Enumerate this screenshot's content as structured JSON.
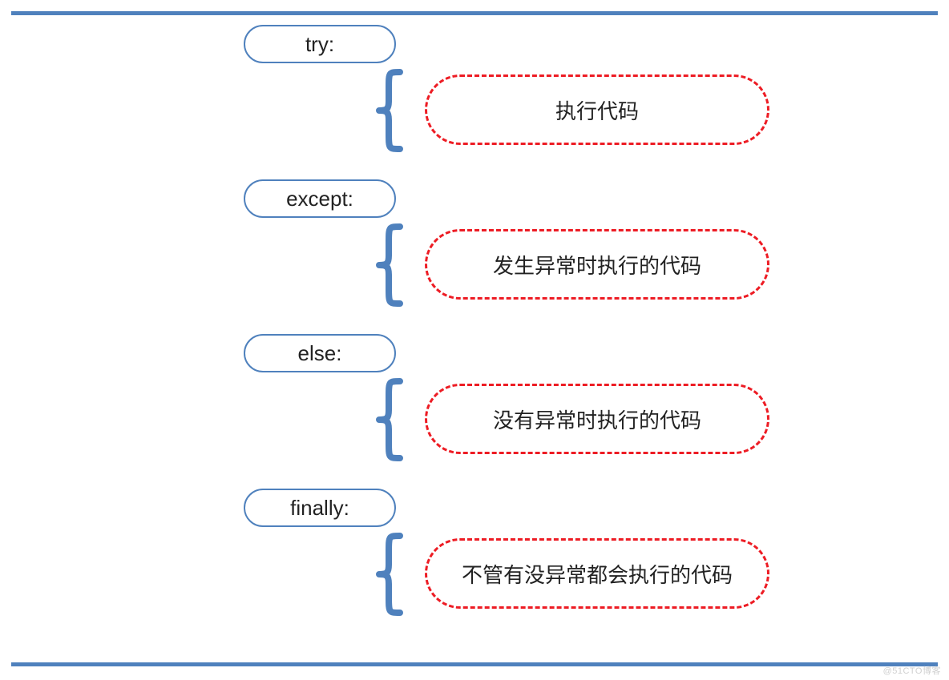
{
  "colors": {
    "blue": "#4F81BD",
    "red": "#ED1C24"
  },
  "blocks": [
    {
      "keyword": "try:",
      "description": "执行代码"
    },
    {
      "keyword": "except:",
      "description": "发生异常时执行的代码"
    },
    {
      "keyword": "else:",
      "description": "没有异常时执行的代码"
    },
    {
      "keyword": "finally:",
      "description": "不管有没异常都会执行的代码"
    }
  ],
  "watermark": "@51CTO博客"
}
